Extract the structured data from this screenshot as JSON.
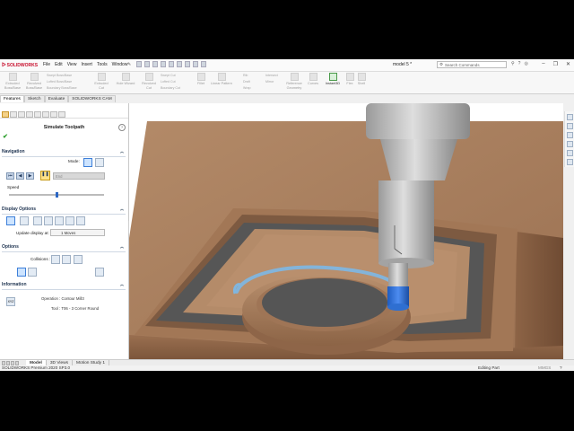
{
  "titlebar": {
    "brand": "SOLIDWORKS",
    "menus": [
      "File",
      "Edit",
      "View",
      "Insert",
      "Tools",
      "Window"
    ],
    "document": "model 5 *",
    "search_placeholder": "Search Commands",
    "window_controls": [
      "minimize-icon",
      "restore-icon",
      "close-icon"
    ]
  },
  "ribbon": {
    "buttons": [
      {
        "label": "Extruded Boss/Base",
        "active": false
      },
      {
        "label": "Revolved Boss/Base",
        "active": false
      },
      {
        "label": "Swept Boss/Base",
        "active": false
      },
      {
        "label": "Lofted Boss/Base",
        "active": false
      },
      {
        "label": "Boundary Boss/Base",
        "active": false
      },
      {
        "label": "Extruded Cut",
        "active": false
      },
      {
        "label": "Hole Wizard",
        "active": false
      },
      {
        "label": "Revolved Cut",
        "active": false
      },
      {
        "label": "Swept Cut",
        "active": false
      },
      {
        "label": "Lofted Cut",
        "active": false
      },
      {
        "label": "Boundary Cut",
        "active": false
      },
      {
        "label": "Fillet",
        "active": false
      },
      {
        "label": "Linear Pattern",
        "active": false
      },
      {
        "label": "Rib",
        "active": false
      },
      {
        "label": "Draft",
        "active": false
      },
      {
        "label": "Wrap",
        "active": false
      },
      {
        "label": "Intersect",
        "active": false
      },
      {
        "label": "Mirror",
        "active": false
      },
      {
        "label": "Reference Geometry",
        "active": false
      },
      {
        "label": "Curves",
        "active": false
      },
      {
        "label": "Instant3D",
        "active": true
      },
      {
        "label": "Flex",
        "active": false
      },
      {
        "label": "Shell",
        "active": false
      }
    ]
  },
  "command_tabs": [
    {
      "label": "Features",
      "active": true
    },
    {
      "label": "Sketch",
      "active": false
    },
    {
      "label": "Evaluate",
      "active": false
    },
    {
      "label": "SOLIDWORKS CAM",
      "active": false
    }
  ],
  "panel": {
    "title": "Simulate Toolpath",
    "navigation": {
      "heading": "Navigation",
      "mode_label": "Mode:",
      "end_label": "End",
      "speed_label": "Speed",
      "speed_value": 0.5
    },
    "display_options": {
      "heading": "Display Options",
      "update_label": "Update display at:",
      "update_value": "1 Moves"
    },
    "options": {
      "heading": "Options",
      "collisions_label": "Collisions :"
    },
    "information": {
      "heading": "Information",
      "operation": "Operation : Contour Mill3",
      "tool": "Tool : T06 - 3 Corner Round",
      "xyz": "XYZ"
    }
  },
  "bottom_tabs": [
    {
      "label": "Model",
      "active": true
    },
    {
      "label": "3D Views",
      "active": false
    },
    {
      "label": "Motion Study 1",
      "active": false
    }
  ],
  "status": {
    "product": "SOLIDWORKS Premium 2020 SP3.0",
    "mode": "Editing Part",
    "units": "MMGS"
  },
  "colors": {
    "stock": "#a97c5a",
    "pocket_floor": "#565656",
    "toolpath": "#7fb6e0",
    "tool_tip": "#2f6fd1",
    "spindle": "#c4c4c4"
  }
}
